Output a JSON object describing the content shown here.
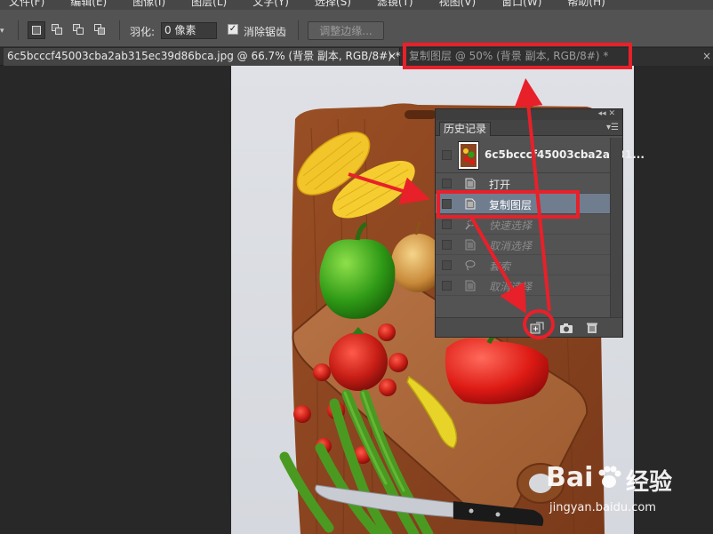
{
  "menu": {
    "items": [
      "文件(F)",
      "编辑(E)",
      "图像(I)",
      "图层(L)",
      "文字(Y)",
      "选择(S)",
      "滤镜(T)",
      "视图(V)",
      "窗口(W)",
      "帮助(H)"
    ]
  },
  "options": {
    "feather_label": "羽化:",
    "feather_value": "0 像素",
    "antialias_label": "消除锯齿",
    "antialias_checked": true,
    "refine_edge_label": "调整边缘..."
  },
  "tabs": [
    {
      "label": "6c5bcccf45003cba2ab315ec39d86bca.jpg @ 66.7% (背景 副本, RGB/8#) *",
      "close": "×"
    },
    {
      "label": "复制图层 @ 50% (背景 副本, RGB/8#) *",
      "close": "×"
    }
  ],
  "history_panel": {
    "collapse_glyph": "◂◂ ✕",
    "tab_label": "历史记录",
    "menu_glyph": "▾☰",
    "snapshot_label": "6c5bcccf45003cba2ab31...",
    "items": [
      {
        "label": "打开",
        "state": "normal",
        "icon": "document-icon"
      },
      {
        "label": "复制图层",
        "state": "selected",
        "icon": "document-icon"
      },
      {
        "label": "快速选择",
        "state": "dim",
        "icon": "quick-select-icon"
      },
      {
        "label": "取消选择",
        "state": "dim",
        "icon": "document-icon"
      },
      {
        "label": "套索",
        "state": "dim",
        "icon": "lasso-icon"
      },
      {
        "label": "取消选择",
        "state": "dim",
        "icon": "document-icon"
      }
    ],
    "bottom_icons": [
      "new-document-from-state-icon",
      "camera-icon",
      "trash-icon"
    ]
  },
  "canvas_image": {
    "subject": "vegetables-on-cutting-board-photo"
  },
  "annotations": {
    "color": "#e8202a"
  },
  "watermark": {
    "brand": "Bai",
    "brand_suffix": "经验",
    "url": "jingyan.baidu.com"
  },
  "colors": {
    "app_bg": "#282828",
    "options_bg": "#535353",
    "panel_bg": "#535353",
    "selected_row": "#6f7d8f",
    "highlight_red": "#e8202a"
  }
}
